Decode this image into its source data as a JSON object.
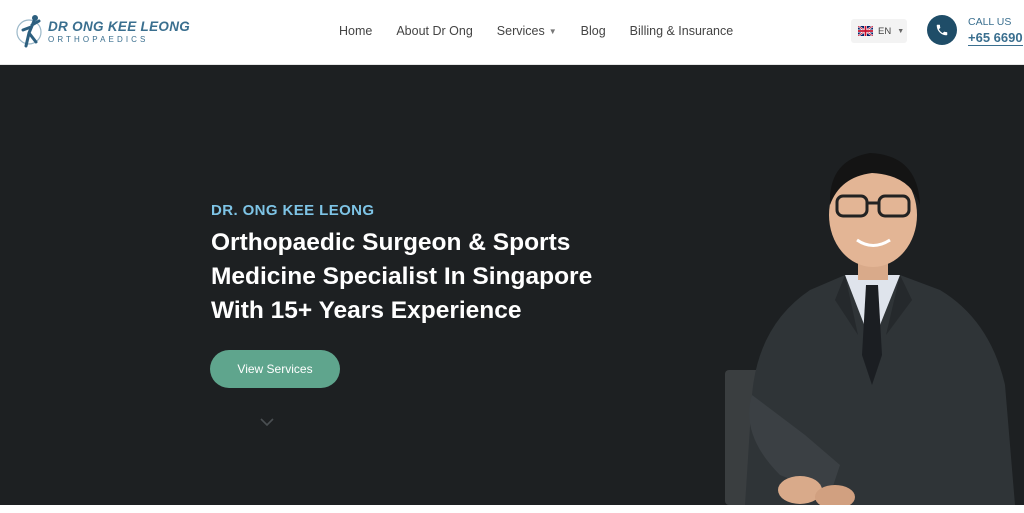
{
  "header": {
    "logo": {
      "name": "DR ONG KEE LEONG",
      "sub": "ORTHOPAEDICS"
    },
    "nav": [
      {
        "label": "Home",
        "has_dropdown": false
      },
      {
        "label": "About Dr Ong",
        "has_dropdown": false
      },
      {
        "label": "Services",
        "has_dropdown": true
      },
      {
        "label": "Blog",
        "has_dropdown": false
      },
      {
        "label": "Billing & Insurance",
        "has_dropdown": false
      }
    ],
    "language": {
      "code": "EN",
      "flag_icon": "uk-flag-icon"
    },
    "contact": {
      "label": "CALL US",
      "number": "+65 6690"
    }
  },
  "hero": {
    "eyebrow": "DR. ONG KEE LEONG",
    "headline_lines": [
      "Orthopaedic Surgeon & Sports",
      "Medicine Specialist In Singapore",
      "With 15+ Years Experience"
    ],
    "cta": "View Services",
    "scroll_icon": "chevron-down-icon"
  },
  "colors": {
    "brand_blue": "#3a6f8f",
    "phone_circle": "#1f4d68",
    "hero_bg": "#1d2022",
    "eyebrow": "#7ec4e6",
    "cta_green": "#5fa58d"
  }
}
